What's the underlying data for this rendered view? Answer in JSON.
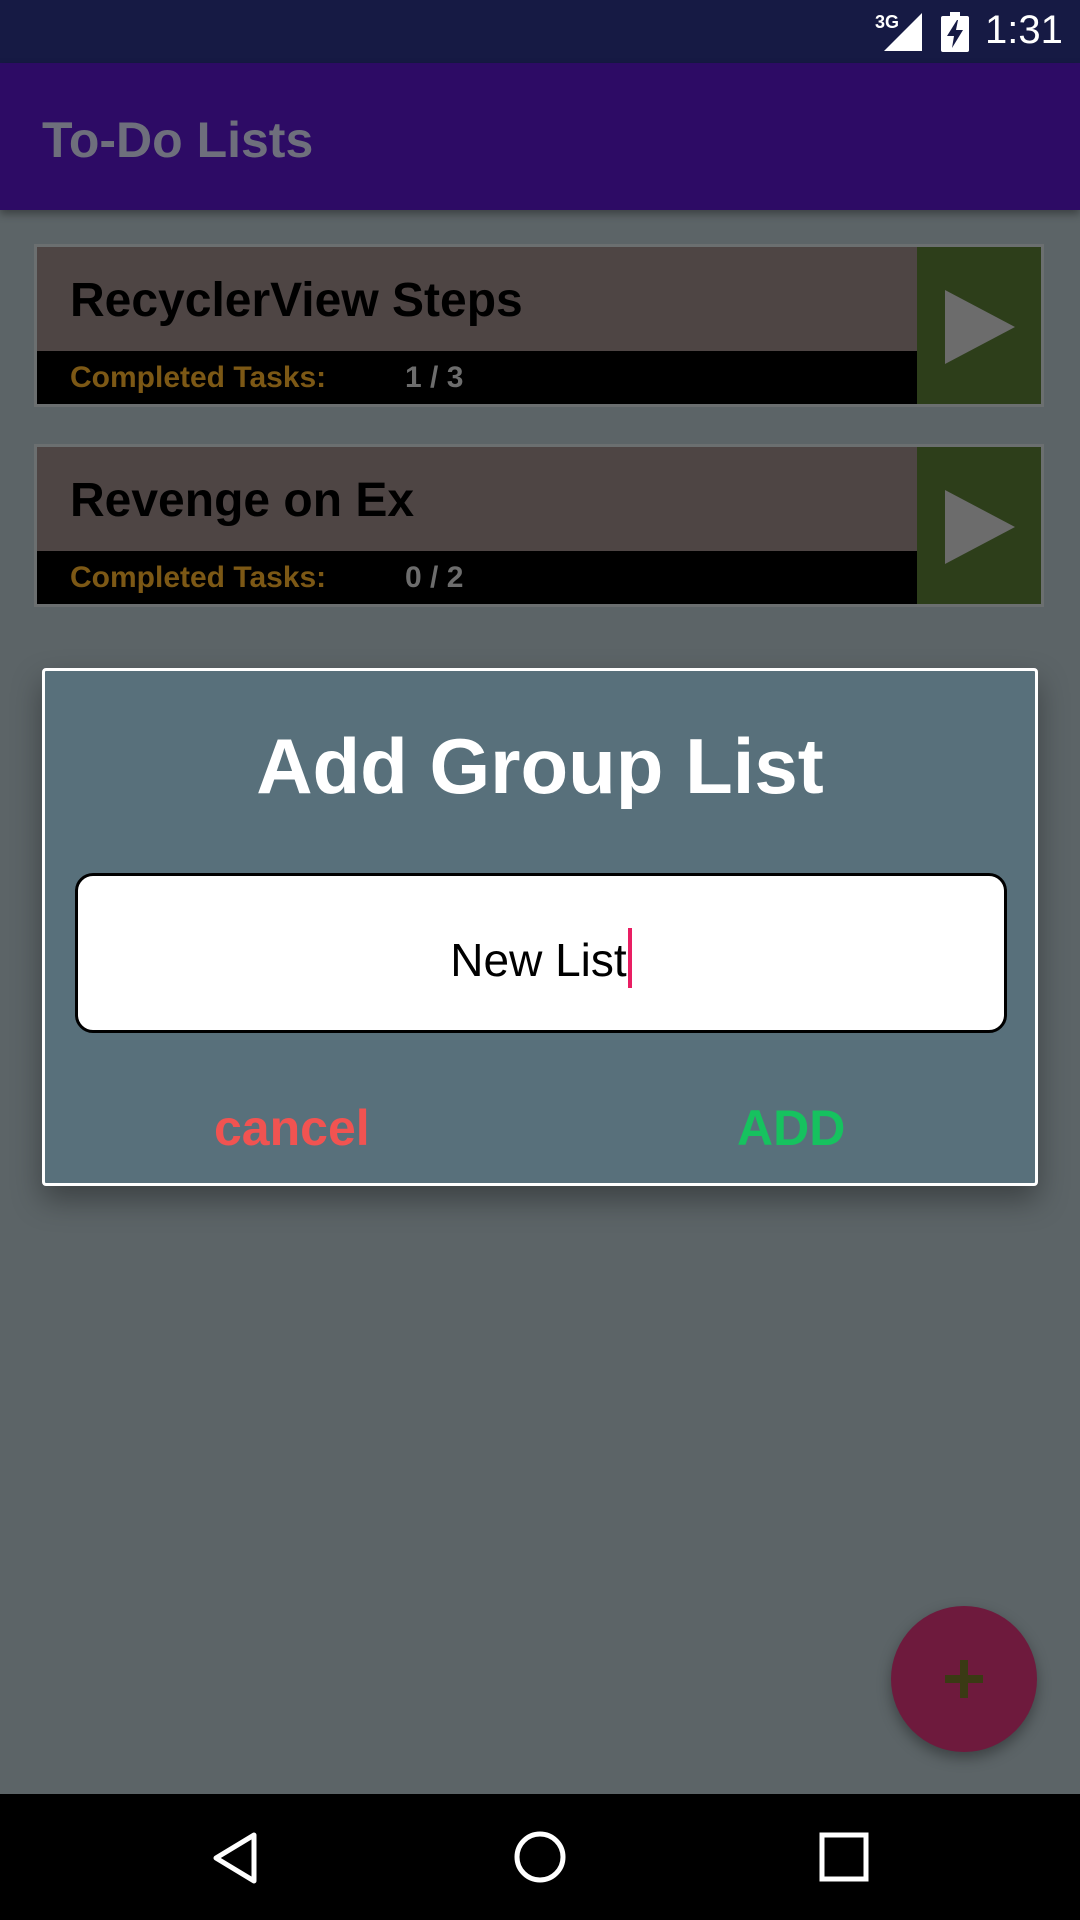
{
  "status_bar": {
    "network_label": "3G",
    "time": "1:31",
    "icons": [
      "signal-icon",
      "battery-charging-icon"
    ]
  },
  "app_bar": {
    "title": "To-Do Lists"
  },
  "lists": [
    {
      "title": "RecyclerView Steps",
      "completed_label": "Completed Tasks:",
      "completed_value": "1 / 3"
    },
    {
      "title": "Revenge on Ex",
      "completed_label": "Completed Tasks:",
      "completed_value": "0 / 2"
    }
  ],
  "dialog": {
    "title": "Add Group List",
    "input_value": "New List",
    "cancel_label": "cancel",
    "add_label": "ADD"
  },
  "fab": {
    "icon": "plus-icon"
  },
  "nav_bar": {
    "icons": [
      "back-icon",
      "home-icon",
      "recents-icon"
    ]
  },
  "colors": {
    "status_bar": "#161a44",
    "app_bar": "#2d0b65",
    "scrim_background": "#5c6467",
    "card_header": "#4e4544",
    "card_footer": "#000000",
    "completed_label": "#7c5815",
    "open_button": "#2d3e1a",
    "dialog_background": "#58707b",
    "cancel": "#f15351",
    "add": "#16c25f",
    "caret": "#e91e63",
    "fab": "#6e1a3d"
  }
}
